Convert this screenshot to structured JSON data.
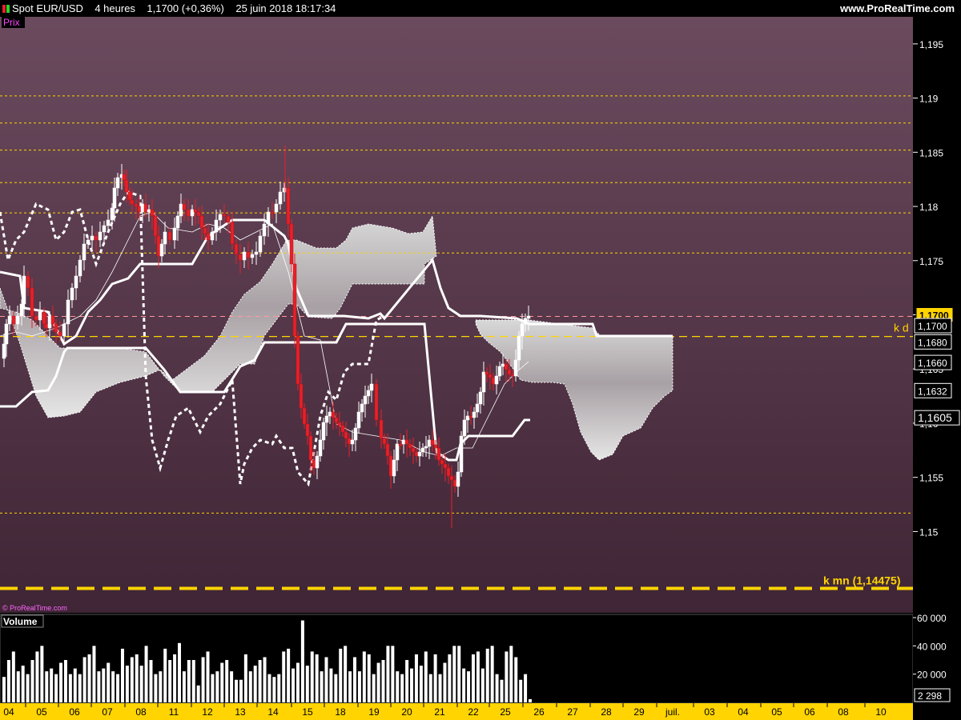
{
  "header": {
    "symbol": "Spot EUR/USD",
    "timeframe": "4 heures",
    "last": "1,1700",
    "change": "(+0,36%)",
    "datetime": "25 juin 2018 18:17:34",
    "site": "www.ProRealTime.com"
  },
  "panels": {
    "price_label": "Prix",
    "volume_label": "Volume",
    "watermark": "© ProRealTime.com"
  },
  "colors": {
    "up": "#ffffff",
    "down": "#e8202a",
    "level": "#ffd400",
    "bg_top": "#6b4a5e",
    "bg_bottom": "#3f2535"
  },
  "chart_data": [
    {
      "type": "candlestick",
      "title": "Spot EUR/USD 4 heures",
      "ylim": [
        1.1425,
        1.1975
      ],
      "y_ticks": [
        "1,195",
        "1,19",
        "1,185",
        "1,18",
        "1,175",
        "1,17",
        "1,165",
        "1,16",
        "1,155",
        "1,15"
      ],
      "x_ticks": [
        "04",
        "05",
        "06",
        "07",
        "08",
        "11",
        "12",
        "13",
        "14",
        "15",
        "18",
        "19",
        "20",
        "21",
        "22",
        "25",
        "26",
        "27",
        "28",
        "29",
        "juil.",
        "03",
        "04",
        "05",
        "06",
        "08",
        "10"
      ],
      "dotted_levels": [
        1.1902,
        1.1877,
        1.1852,
        1.1822,
        1.1794,
        1.1757,
        1.1517
      ],
      "dashed_level": 1.168,
      "dashed_level_label": "k d",
      "thick_level": 1.14475,
      "thick_level_label": "k mn (1,14475)",
      "price_tags": [
        {
          "text": "1,1700",
          "value": 1.17,
          "style": "last"
        },
        {
          "text": "1,1700",
          "value": 1.169,
          "style": "white"
        },
        {
          "text": "1,1680",
          "value": 1.1675,
          "style": "white"
        },
        {
          "text": "1,1660",
          "value": 1.1656,
          "style": "white"
        },
        {
          "text": "1,1632",
          "value": 1.163,
          "style": "white"
        },
        {
          "text": "1,1605",
          "value": 1.1605,
          "style": "white"
        }
      ],
      "series": [
        {
          "name": "EUR/USD",
          "close_approx": [
            1.166,
            1.168,
            1.17,
            1.176,
            1.175,
            1.18,
            1.18,
            1.176,
            1.177,
            1.18,
            1.176,
            1.171,
            1.163,
            1.162,
            1.16,
            1.162,
            1.157,
            1.156,
            1.158,
            1.158,
            1.157,
            1.162,
            1.164,
            1.168,
            1.17
          ]
        }
      ]
    },
    {
      "type": "bar",
      "title": "Volume",
      "ylim": [
        0,
        60000
      ],
      "y_ticks": [
        "60 000",
        "40 000",
        "20 000"
      ],
      "last_value": "2 298",
      "values": [
        18000,
        30000,
        36000,
        22000,
        26000,
        20000,
        30000,
        36000,
        40000,
        22000,
        24000,
        20000,
        28000,
        30000,
        20000,
        24000,
        20000,
        32000,
        34000,
        40000,
        22000,
        24000,
        28000,
        22000,
        20000,
        38000,
        26000,
        32000,
        34000,
        26000,
        40000,
        30000,
        20000,
        22000,
        38000,
        30000,
        34000,
        42000,
        22000,
        30000,
        30000,
        12000,
        32000,
        36000,
        20000,
        22000,
        28000,
        30000,
        22000,
        16000,
        16000,
        34000,
        22000,
        26000,
        30000,
        32000,
        20000,
        18000,
        20000,
        36000,
        38000,
        24000,
        28000,
        58000,
        26000,
        36000,
        34000,
        22000,
        32000,
        24000,
        20000,
        38000,
        40000,
        22000,
        32000,
        22000,
        36000,
        34000,
        20000,
        28000,
        30000,
        40000,
        40000,
        22000,
        20000,
        30000,
        24000,
        34000,
        26000,
        36000,
        20000,
        34000,
        20000,
        28000,
        34000,
        40000,
        40000,
        24000,
        22000,
        34000,
        36000,
        24000,
        38000,
        40000,
        20000,
        16000,
        36000,
        40000,
        32000,
        16000,
        20000,
        2298
      ]
    }
  ]
}
